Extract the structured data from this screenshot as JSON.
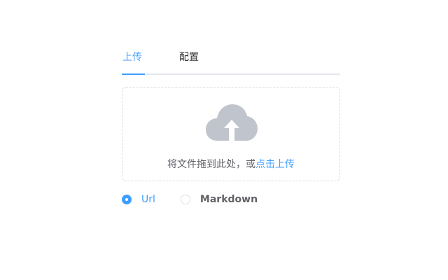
{
  "tabs": {
    "upload_label": "上传",
    "config_label": "配置",
    "active": "upload"
  },
  "dropzone": {
    "icon": "upload-cloud-icon",
    "text_prefix": "将文件拖到此处，或",
    "link_text": "点击上传"
  },
  "format": {
    "options": [
      {
        "label": "Url",
        "selected": true
      },
      {
        "label": "Markdown",
        "selected": false
      }
    ]
  },
  "colors": {
    "accent": "#409eff",
    "border": "#d9d9d9",
    "icon": "#c0c4cc",
    "text": "#606266"
  }
}
